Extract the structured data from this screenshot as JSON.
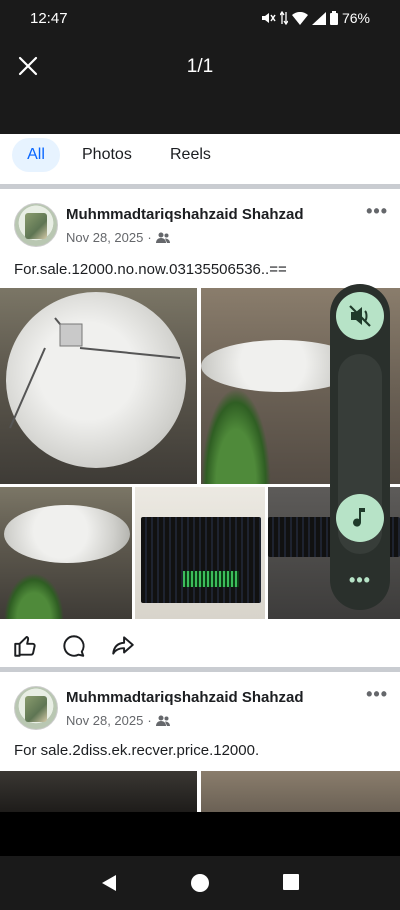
{
  "status": {
    "time": "12:47",
    "battery": "76%"
  },
  "viewer": {
    "counter": "1/1"
  },
  "tabs": [
    {
      "label": "All",
      "active": true
    },
    {
      "label": "Photos",
      "active": false
    },
    {
      "label": "Reels",
      "active": false
    }
  ],
  "posts": [
    {
      "author": "Muhmmadtariqshahzaid Shahzad",
      "date": "Nov 28, 2025",
      "text": "For.sale.12000.no.now.03135506536..=="
    },
    {
      "author": "Muhmmadtariqshahzaid Shahzad",
      "date": "Nov 28, 2025",
      "text": "For sale.2diss.ek.recver.price.12000."
    }
  ],
  "colors": {
    "accent": "#0866ff",
    "volume_panel": "#2a302c",
    "volume_button": "#b7e3c7"
  },
  "icons": {
    "close": "close-icon",
    "like": "like-icon",
    "comment": "comment-icon",
    "share": "share-icon",
    "mute": "volume-off-icon",
    "music": "music-note-icon",
    "back": "back-triangle-icon",
    "home": "home-circle-icon",
    "recents": "recents-square-icon"
  }
}
